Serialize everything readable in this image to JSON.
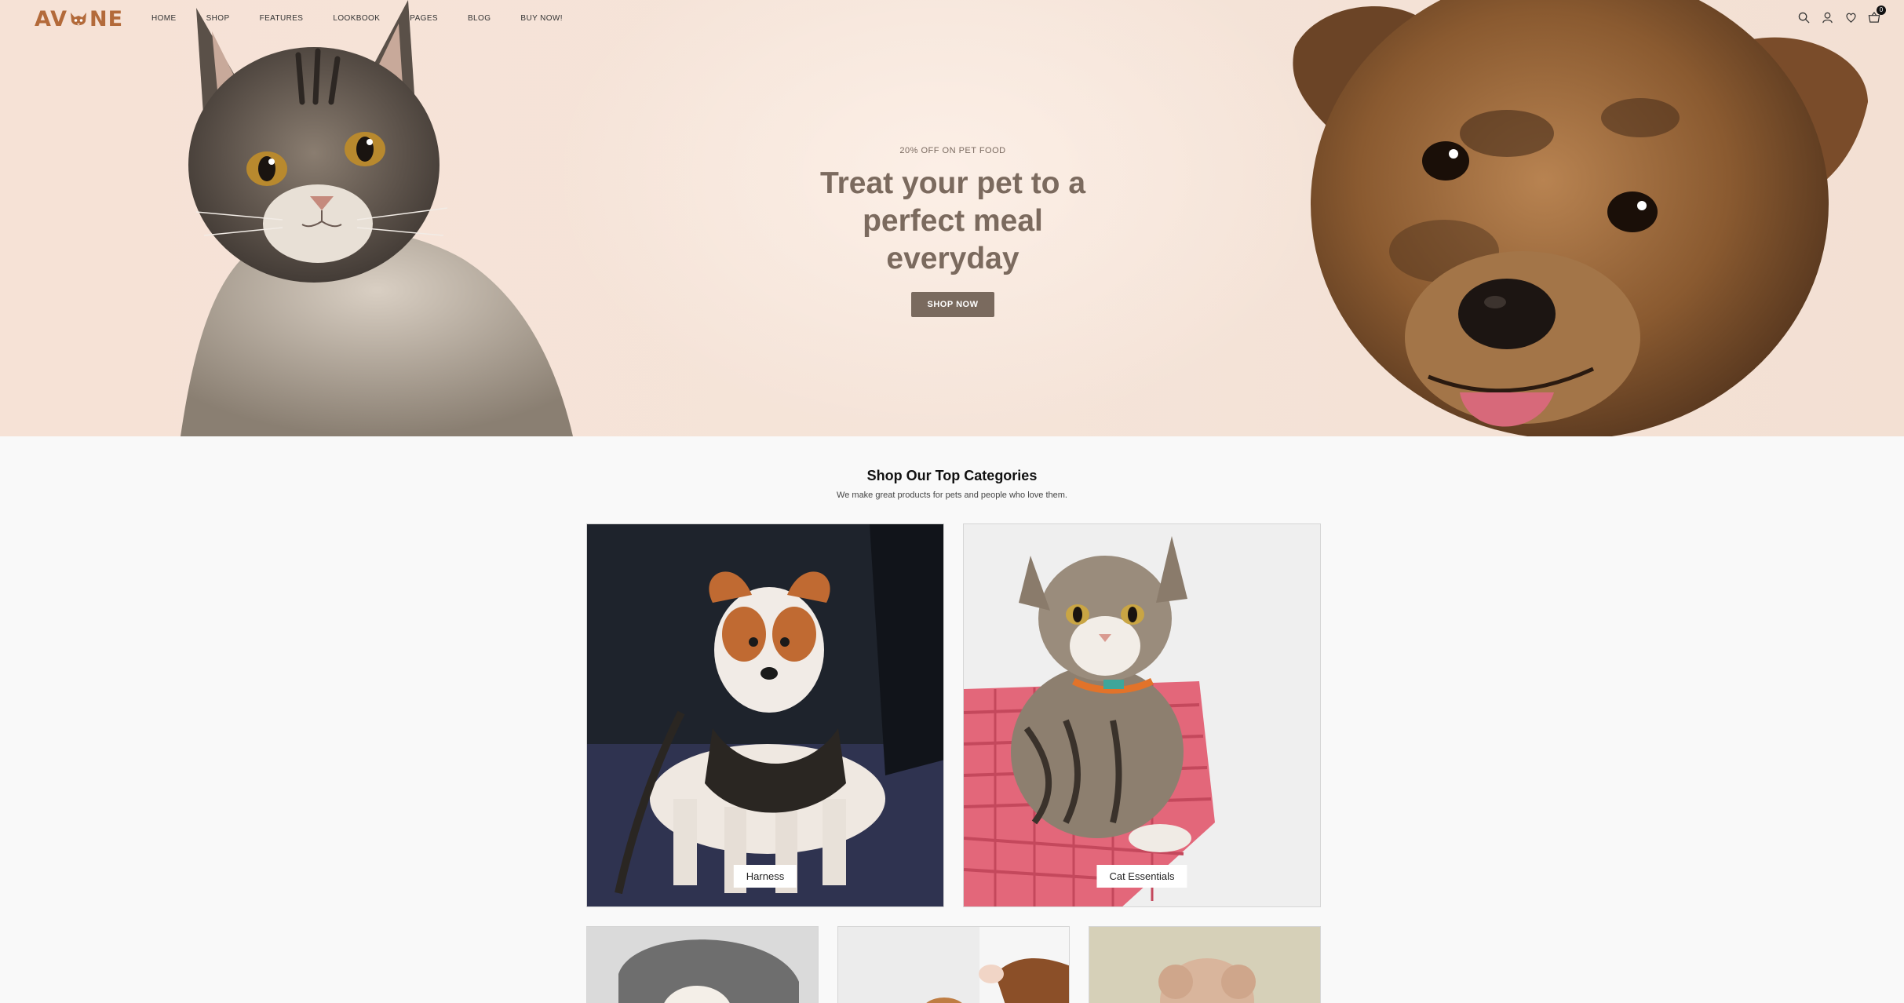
{
  "brand": {
    "name_left": "AV",
    "name_right": "NE",
    "logo_icon": "cat-paw-logo-icon"
  },
  "nav": {
    "items": [
      {
        "label": "HOME"
      },
      {
        "label": "SHOP"
      },
      {
        "label": "FEATURES"
      },
      {
        "label": "LOOKBOOK"
      },
      {
        "label": "PAGES"
      },
      {
        "label": "BLOG"
      },
      {
        "label": "BUY NOW!"
      }
    ],
    "icons": [
      "search-icon",
      "user-icon",
      "heart-icon",
      "cart-icon"
    ],
    "cart_count": "0"
  },
  "hero": {
    "eyebrow": "20% OFF ON PET FOOD",
    "headline_line1": "Treat your pet to a",
    "headline_line2": "perfect meal everyday",
    "cta": "SHOP NOW",
    "background_color": "#f5e4d9",
    "text_color": "#7b6a5e",
    "button_color": "#7a6a5e"
  },
  "categories": {
    "title": "Shop Our Top Categories",
    "subtitle": "We make great products for pets and people who love them.",
    "tiles": [
      {
        "label": "Harness"
      },
      {
        "label": "Cat Essentials"
      }
    ]
  }
}
